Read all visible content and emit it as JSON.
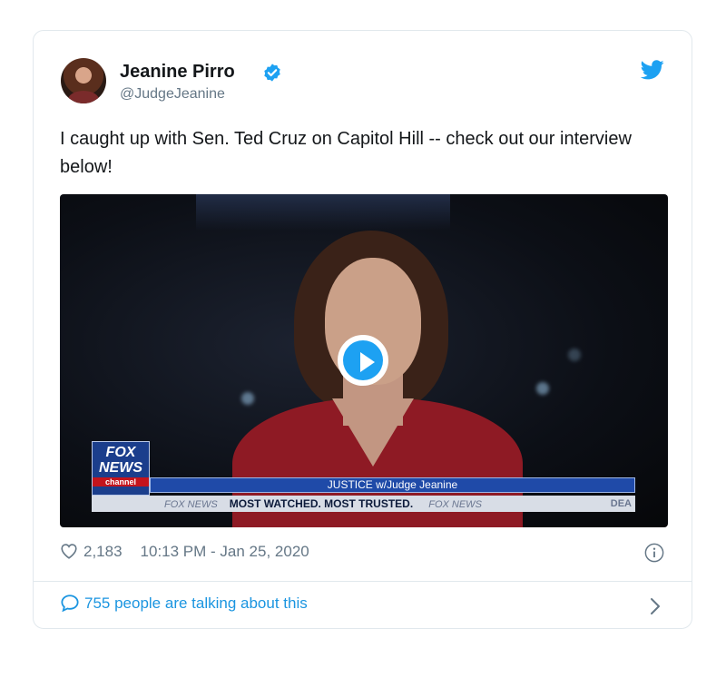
{
  "tweet": {
    "author_name": "Jeanine Pirro",
    "handle": "@JudgeJeanine",
    "text": "I caught up with Sen. Ted Cruz on Capitol Hill -- check out our interview below!",
    "likes": "2,183",
    "timestamp": "10:13 PM - Jan 25, 2020",
    "conversation": "755 people are talking about this"
  },
  "video": {
    "logo_line1": "FOX",
    "logo_line2": "NEWS",
    "logo_line3": "channel",
    "lower_third": "JUSTICE w/Judge Jeanine",
    "ticker_brand": "FOX NEWS",
    "ticker_slogan": "MOST WATCHED. MOST TRUSTED.",
    "ticker_brand2": "FOX NEWS",
    "ticker_tail": "DEA"
  },
  "icons": {
    "verified": "verified-badge-icon",
    "bird": "twitter-bird-icon",
    "play": "play-icon",
    "heart": "heart-icon",
    "info": "info-icon",
    "bubble": "comment-bubble-icon",
    "chevron": "chevron-right-icon"
  },
  "colors": {
    "brand_blue": "#1da1f2",
    "link_blue": "#1b95e0",
    "muted": "#657786",
    "border": "#e1e8ed"
  }
}
